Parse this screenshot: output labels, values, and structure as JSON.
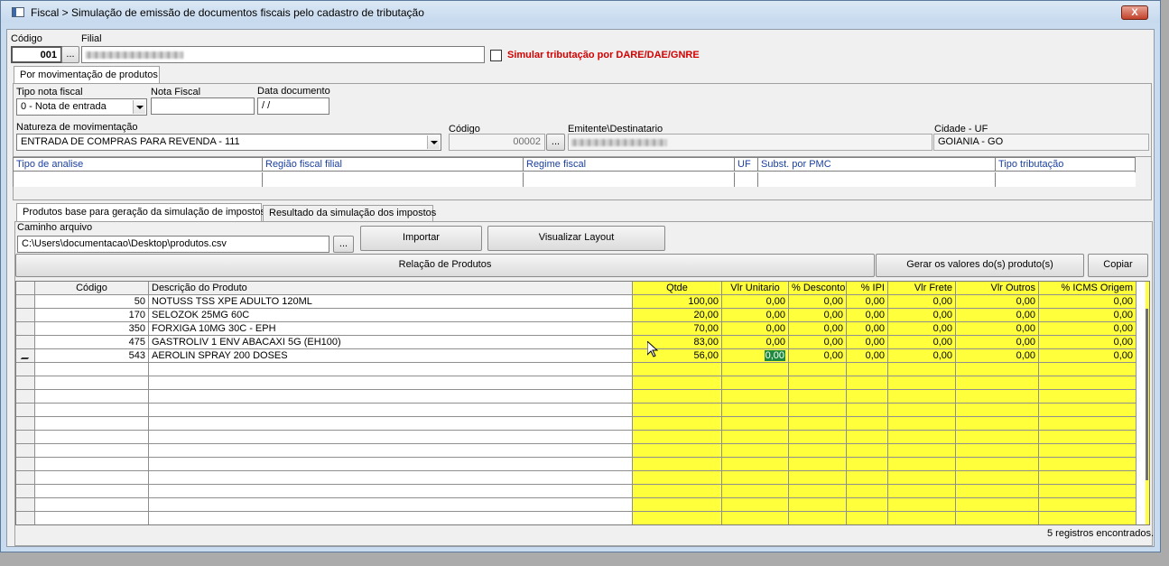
{
  "window": {
    "title": "Fiscal > Simulação de emissão de documentos fiscais pelo cadastro de tributação",
    "close_label": "X"
  },
  "header": {
    "codigo_label": "Código",
    "codigo_value": "001",
    "browse_label": "...",
    "filial_label": "Filial",
    "simular_label": "Simular tributação por DARE/DAE/GNRE"
  },
  "main_tab": {
    "label": "Por movimentação de produtos"
  },
  "documento": {
    "tipo_nota_label": "Tipo nota fiscal",
    "tipo_nota_value": "0 - Nota de entrada",
    "nota_fiscal_label": "Nota Fiscal",
    "nota_fiscal_value": "",
    "data_documento_label": "Data documento",
    "data_documento_value": " /  /",
    "natureza_label": "Natureza de movimentação",
    "natureza_value": "ENTRADA DE COMPRAS PARA REVENDA - 111",
    "codigo_label": "Código",
    "codigo_value": "00002",
    "emitente_label": "Emitente\\Destinatario",
    "cidade_label": "Cidade - UF",
    "cidade_value": "GOIANIA - GO"
  },
  "analysis_table": {
    "columns": [
      "Tipo de analise",
      "Região fiscal filial",
      "Regime fiscal",
      "UF",
      "Subst. por PMC",
      "Tipo tributação"
    ]
  },
  "sub_tabs": [
    {
      "label": "Produtos base para geração da simulação de impostos"
    },
    {
      "label": "Resultado da simulação dos impostos"
    }
  ],
  "arquivo": {
    "caminho_label": "Caminho arquivo",
    "caminho_value": "C:\\Users\\documentacao\\Desktop\\produtos.csv",
    "browse_label": "...",
    "importar_label": "Importar",
    "visualizar_label": "Visualizar Layout"
  },
  "produtos": {
    "relacao_label": "Relação de Produtos",
    "gerar_label": "Gerar os valores do(s) produto(s)",
    "copiar_label": "Copiar",
    "columns": [
      "Código",
      "Descrição do Produto",
      "Qtde",
      "Vlr Unitario",
      "% Desconto",
      "% IPI",
      "Vlr Frete",
      "Vlr Outros",
      "% ICMS Origem"
    ],
    "rows": [
      {
        "codigo": "50",
        "descricao": "NOTUSS TSS XPE ADULTO 120ML",
        "qtde": "100,00",
        "vlr_unitario": "0,00",
        "desconto": "0,00",
        "ipi": "0,00",
        "frete": "0,00",
        "outros": "0,00",
        "icms": "0,00"
      },
      {
        "codigo": "170",
        "descricao": "SELOZOK  25MG 60C",
        "qtde": "20,00",
        "vlr_unitario": "0,00",
        "desconto": "0,00",
        "ipi": "0,00",
        "frete": "0,00",
        "outros": "0,00",
        "icms": "0,00"
      },
      {
        "codigo": "350",
        "descricao": "FORXIGA 10MG 30C - EPH",
        "qtde": "70,00",
        "vlr_unitario": "0,00",
        "desconto": "0,00",
        "ipi": "0,00",
        "frete": "0,00",
        "outros": "0,00",
        "icms": "0,00"
      },
      {
        "codigo": "475",
        "descricao": "GASTROLIV 1 ENV ABACAXI 5G (EH100)",
        "qtde": "83,00",
        "vlr_unitario": "0,00",
        "desconto": "0,00",
        "ipi": "0,00",
        "frete": "0,00",
        "outros": "0,00",
        "icms": "0,00"
      },
      {
        "codigo": "543",
        "descricao": "AEROLIN SPRAY 200 DOSES",
        "qtde": "56,00",
        "vlr_unitario": "0,00",
        "desconto": "0,00",
        "ipi": "0,00",
        "frete": "0,00",
        "outros": "0,00",
        "icms": "0,00"
      }
    ],
    "status": "5 registros encontrados."
  },
  "colors": {
    "highlight": "#ffff3c",
    "simular_text": "#d40000",
    "selected_cell": "#1f8a3e"
  }
}
